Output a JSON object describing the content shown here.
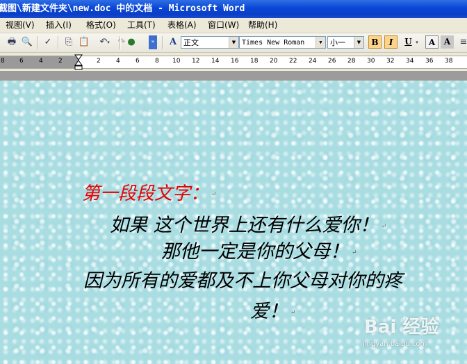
{
  "window": {
    "title": "截图\\新建文件夹\\new.doc 中的文档 - Microsoft Word"
  },
  "menu": {
    "items": [
      {
        "label": "视图(V)"
      },
      {
        "label": "插入(I)"
      },
      {
        "label": "格式(O)"
      },
      {
        "label": "工具(T)"
      },
      {
        "label": "表格(A)"
      },
      {
        "label": "窗口(W)"
      },
      {
        "label": "帮助(H)"
      }
    ]
  },
  "toolbar": {
    "style_value": "正文",
    "font_value": "Times New Roman",
    "size_value": "小一",
    "bold_label": "B",
    "italic_label": "I",
    "underline_label": "U",
    "style_icon_label": "A"
  },
  "ruler": {
    "ticks": [
      "8",
      "6",
      "4",
      "2",
      "2",
      "4",
      "6",
      "8",
      "10",
      "12",
      "14",
      "16",
      "18",
      "20",
      "22",
      "24",
      "26",
      "28",
      "30",
      "32",
      "34",
      "36",
      "38"
    ]
  },
  "document": {
    "heading": "第一段段文字：",
    "lines": [
      "如果 这个世界上还有什么爱你！",
      "那他一定是你的父母！",
      "因为所有的爱都及不上你父母对你的疼",
      "爱！"
    ],
    "para_mark": "↵"
  },
  "watermark": {
    "main": "Bai 经验",
    "sub": "jingyan.baidu.com"
  }
}
